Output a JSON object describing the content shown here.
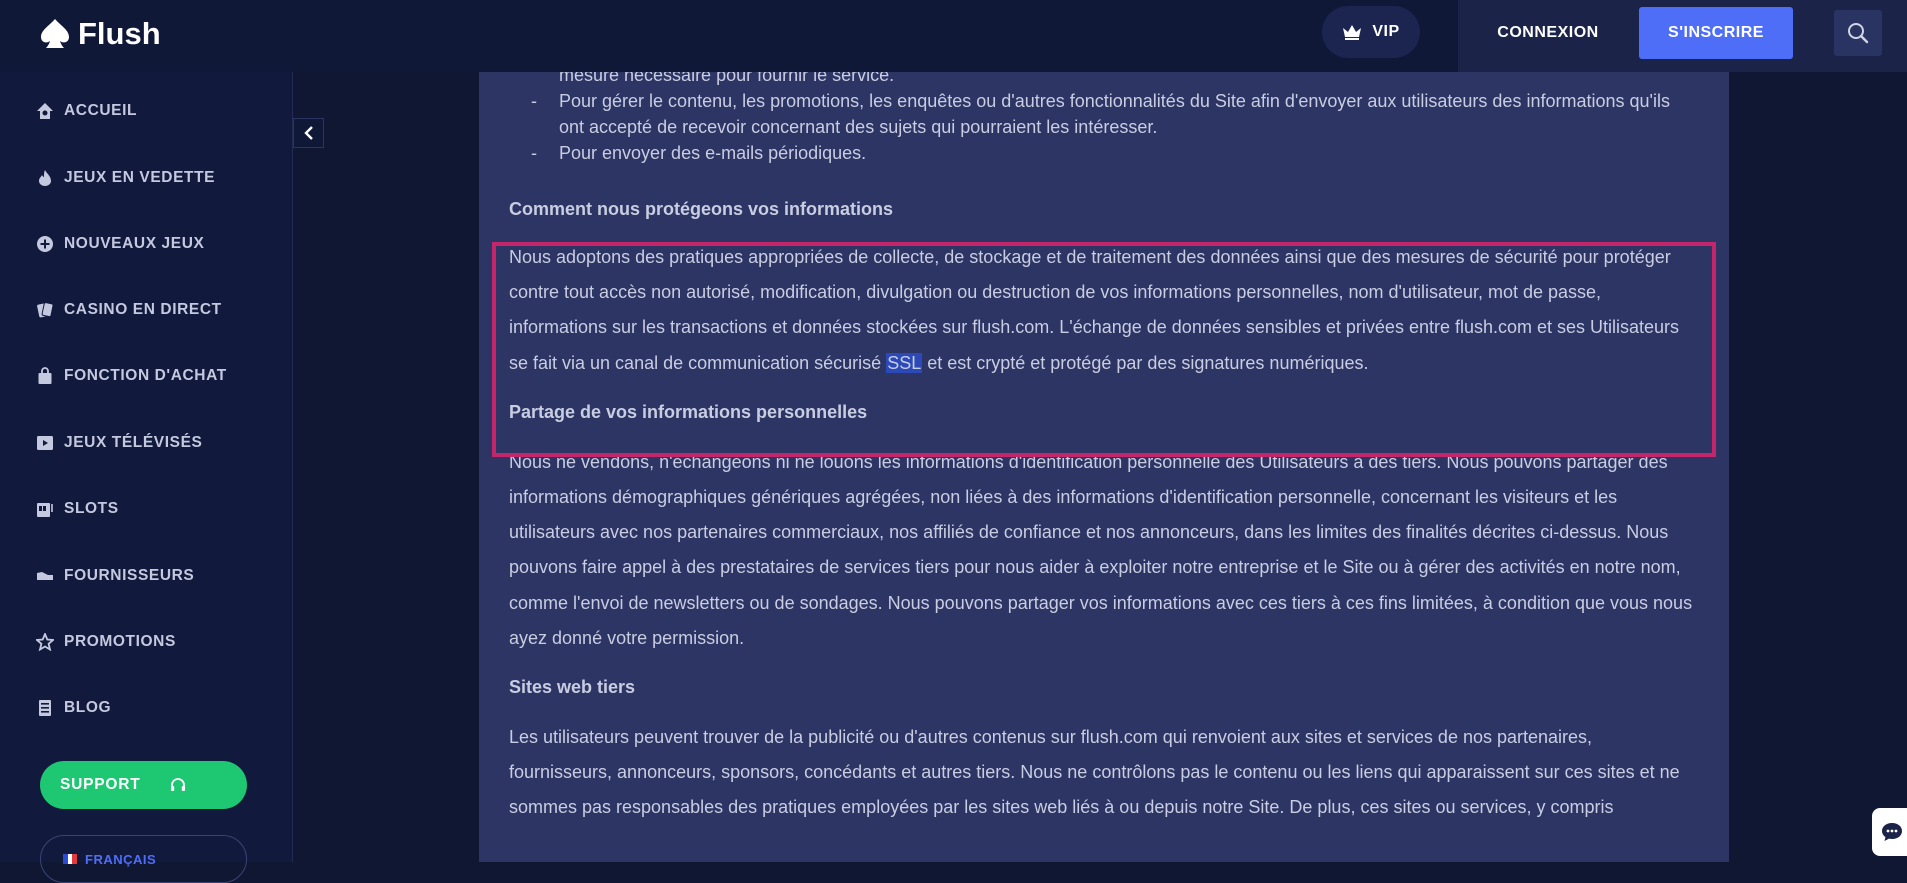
{
  "header": {
    "logo_text": "Flush",
    "vip_label": "VIP",
    "login_label": "CONNEXION",
    "signup_label": "S'INSCRIRE",
    "search_icon": "search-icon"
  },
  "sidebar": {
    "items": [
      {
        "label": "ACCUEIL",
        "icon": "home-icon"
      },
      {
        "label": "JEUX EN VEDETTE",
        "icon": "fire-icon"
      },
      {
        "label": "NOUVEAUX JEUX",
        "icon": "plus-circle-icon"
      },
      {
        "label": "CASINO EN DIRECT",
        "icon": "cards-icon"
      },
      {
        "label": "FONCTION D'ACHAT",
        "icon": "shopping-bag-icon"
      },
      {
        "label": "JEUX TÉLÉVISÉS",
        "icon": "tv-play-icon"
      },
      {
        "label": "SLOTS",
        "icon": "slot-machine-icon"
      },
      {
        "label": "FOURNISSEURS",
        "icon": "provider-icon"
      },
      {
        "label": "PROMOTIONS",
        "icon": "star-icon"
      },
      {
        "label": "BLOG",
        "icon": "document-icon"
      }
    ],
    "support_label": "SUPPORT",
    "language_label": "FRANÇAIS"
  },
  "content": {
    "bullet_partial": "mesure nécessaire pour fournir le service.",
    "bullet_2": "Pour gérer le contenu, les promotions, les enquêtes ou d'autres fonctionnalités du Site afin d'envoyer aux utilisateurs des informations qu'ils ont accepté de recevoir concernant des sujets qui pourraient les intéresser.",
    "bullet_3": "Pour envoyer des e-mails périodiques.",
    "bullet_dash": "-",
    "section_protect": {
      "heading": "Comment nous protégeons vos informations",
      "body_before": "Nous adoptons des pratiques appropriées de collecte, de stockage et de traitement des données ainsi que des mesures de sécurité pour protéger contre tout accès non autorisé, modification, divulgation ou destruction de vos informations personnelles, nom d'utilisateur, mot de passe, informations sur les transactions et données stockées sur flush.com. L'échange de données sensibles et privées entre flush.com et ses Utilisateurs se fait via un canal de communication sécurisé ",
      "body_highlight": "SSL",
      "body_after": " et est crypté et protégé par des signatures numériques."
    },
    "section_share": {
      "heading": "Partage de vos informations personnelles",
      "body": "Nous ne vendons, n'échangeons ni ne louons les informations d'identification personnelle des Utilisateurs à des tiers. Nous pouvons partager des informations démographiques génériques agrégées, non liées à des informations d'identification personnelle, concernant les visiteurs et les utilisateurs avec nos partenaires commerciaux, nos affiliés de confiance et nos annonceurs, dans les limites des finalités décrites ci-dessus. Nous pouvons faire appel à des prestataires de services tiers pour nous aider à exploiter notre entreprise et le Site ou à gérer des activités en notre nom, comme l'envoi de newsletters ou de sondages. Nous pouvons partager vos informations avec ces tiers à ces fins limitées, à condition que vous nous ayez donné votre permission."
    },
    "section_thirdparty": {
      "heading": "Sites web tiers",
      "body": "Les utilisateurs peuvent trouver de la publicité ou d'autres contenus sur flush.com qui renvoient aux sites et services de nos partenaires, fournisseurs, annonceurs, sponsors, concédants et autres tiers. Nous ne contrôlons pas le contenu ou les liens qui apparaissent sur ces sites et ne sommes pas responsables des pratiques employées par les sites web liés à ou depuis notre Site. De plus, ces sites ou services, y compris"
    }
  },
  "colors": {
    "accent": "#4f6ef7",
    "support_green": "#1ec872",
    "highlight_border": "#c4266b"
  }
}
